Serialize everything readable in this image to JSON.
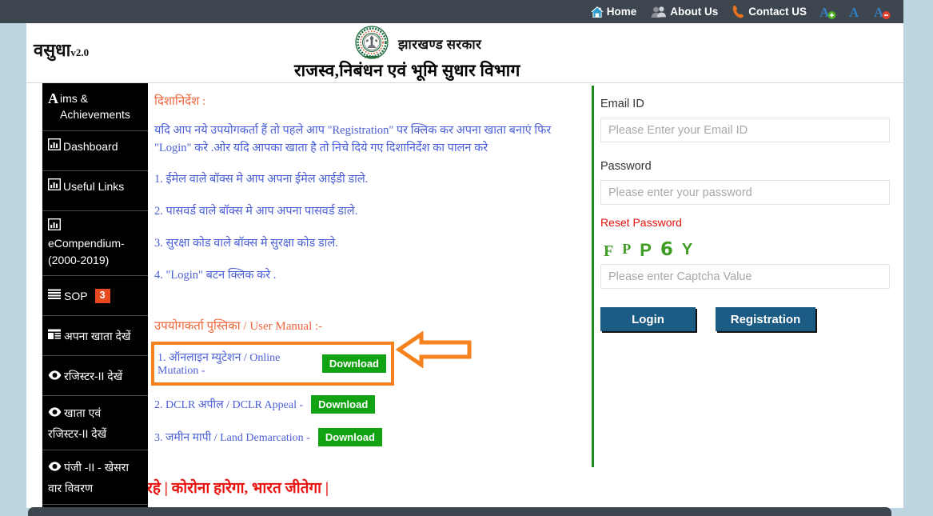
{
  "topbar": {
    "items": [
      {
        "icon": "home-icon",
        "label": "Home"
      },
      {
        "icon": "users-icon",
        "label": "About Us"
      },
      {
        "icon": "phone-icon",
        "label": "Contact US"
      }
    ],
    "font_controls": [
      {
        "icon": "font-increase-icon",
        "label": "A+"
      },
      {
        "icon": "font-normal-icon",
        "label": "A"
      },
      {
        "icon": "font-decrease-icon",
        "label": "A-"
      }
    ]
  },
  "header": {
    "brand": "वसुधा",
    "brand_version": "v2.0",
    "emblem": "jharkhand-government-emblem",
    "gov_line1": "झारखण्ड  सरकार",
    "gov_line2": "राजस्व,निबंधन एवं भूमि सुधार विभाग"
  },
  "sidebar": {
    "items": [
      {
        "label": "ims &",
        "label2": "Achievements",
        "prefix": "A",
        "icon": "letter-a-icon",
        "badge": ""
      },
      {
        "label": "Dashboard",
        "icon": "bar-chart-icon",
        "badge": ""
      },
      {
        "label": "Useful Links",
        "icon": "bar-chart-icon",
        "badge": ""
      },
      {
        "label": "eCompendium-",
        "label2": "(2000-2019)",
        "icon": "bar-chart-icon",
        "badge": ""
      },
      {
        "label": "SOP",
        "icon": "list-lines-icon",
        "badge": "3"
      },
      {
        "label": "अपना खाता देखें",
        "icon": "list-detail-icon",
        "badge": ""
      },
      {
        "label": "रजिस्टर-II देखें",
        "icon": "eye-icon",
        "badge": ""
      },
      {
        "label": "खाता एवं",
        "label2": "रजिस्टर-II देखें",
        "icon": "eye-icon",
        "badge": ""
      },
      {
        "label": "पंजी -II - खेसरा",
        "label2": "वार विवरण",
        "icon": "eye-icon",
        "badge": ""
      }
    ]
  },
  "content": {
    "guidelines_title": "दिशानिर्देश :",
    "intro": "यदि आप नये उपयोगकर्ता हैं तो पहले आप \"Registration\" पर क्लिक कर अपना खाता बनाएं फिर \"Login\" करे .ओर यदि आपका खाता है तो निचे दिये गए दिशानिर्देश का पालन करे",
    "steps": [
      "1. ईमेल वाले बॉक्स मे आप अपना ईमेल आईडी डाले.",
      "2. पासवर्ड वाले बॉक्स मे आप अपना पासवर्ड डाले.",
      "3. सुरक्षा कोड वाले बॉक्स मे सुरक्षा कोड डाले.",
      "4. \"Login\" बटन क्लिक करे ."
    ],
    "manual_title": "उपयोगकर्ता पुस्तिका / User Manual :-",
    "manuals": [
      {
        "label": "1. ऑनलाइन म्युटेशन / Online Mutation -",
        "button": "Download",
        "highlighted": true
      },
      {
        "label": "2. DCLR अपील / DCLR Appeal -",
        "button": "Download",
        "highlighted": false
      },
      {
        "label": "3. जमीन मापी / Land Demarcation -",
        "button": "Download",
        "highlighted": false
      }
    ],
    "annotation_arrow": "left-pointing-arrow",
    "covid_banner": "क्षित रहे | कोरोना हारेगा, भारत जीतेगा |"
  },
  "login": {
    "email_label": "Email ID",
    "email_placeholder": "Please Enter your Email ID",
    "email_value": "",
    "password_label": "Password",
    "password_placeholder": "Please enter your password",
    "password_value": "",
    "reset_password": "Reset Password",
    "captcha_chars": [
      "F",
      "P",
      "P",
      "6",
      "Y"
    ],
    "captcha_placeholder": "Please enter Captcha Value",
    "captcha_value": "",
    "login_button": "Login",
    "registration_button": "Registration"
  },
  "colors": {
    "topbar_bg": "#3d454e",
    "page_bg": "#bdd5e0",
    "sidebar_bg": "#000000",
    "accent_orange": "#f5821f",
    "heading_orange": "#f0663c",
    "text_blue": "#4b5fd6",
    "download_green": "#12a312",
    "divider_green": "#1a8a1a",
    "button_blue": "#1b5b84",
    "badge_red": "#e8491d",
    "covid_red": "#e8130f",
    "captcha_green": "#3f9c24"
  }
}
